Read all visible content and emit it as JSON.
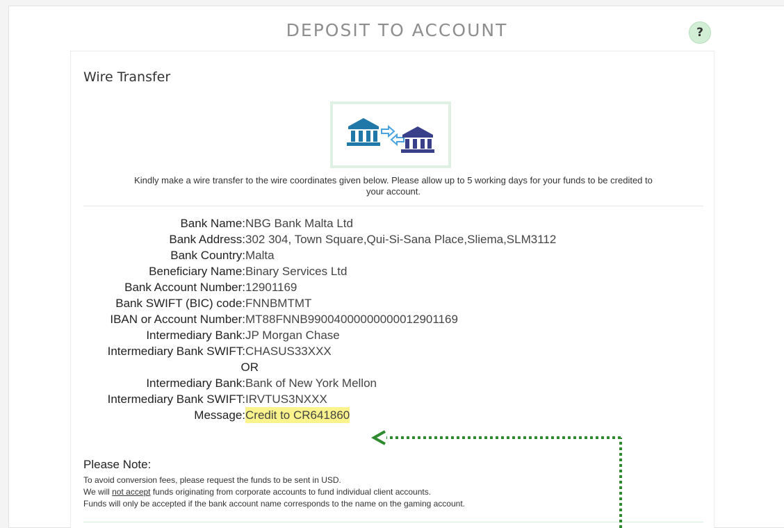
{
  "header": {
    "title": "DEPOSIT TO ACCOUNT",
    "help_label": "?"
  },
  "panel": {
    "title": "Wire Transfer",
    "logo_icon": "bank-transfer-icon",
    "instructions_line1": "Kindly make a wire transfer to the wire coordinates given below. Please allow up to 5 working days for your funds to be credited to",
    "instructions_line2": "your account."
  },
  "details": [
    {
      "label": "Bank Name:",
      "value": "NBG Bank Malta Ltd"
    },
    {
      "label": "Bank Address:",
      "value": "302 304, Town Square,Qui-Si-Sana Place,Sliema,SLM3112"
    },
    {
      "label": "Bank Country:",
      "value": "Malta"
    },
    {
      "label": "Beneficiary Name:",
      "value": "Binary Services Ltd"
    },
    {
      "label": "Bank Account Number:",
      "value": "12901169"
    },
    {
      "label": "Bank SWIFT (BIC) code:",
      "value": "FNNBMTMT"
    },
    {
      "label": "IBAN or Account Number:",
      "value": "MT88FNNB99004000000000012901169"
    },
    {
      "label": "Intermediary Bank:",
      "value": "JP Morgan Chase"
    },
    {
      "label": "Intermediary Bank SWIFT:",
      "value": "CHASUS33XXX"
    },
    {
      "label": "OR",
      "value": ""
    },
    {
      "label": "Intermediary Bank:",
      "value": "Bank of New York Mellon"
    },
    {
      "label": "Intermediary Bank SWIFT:",
      "value": "IRVTUS3NXXX"
    },
    {
      "label": "Message:",
      "value": "Credit to CR641860"
    }
  ],
  "note": {
    "title": "Please Note:",
    "line1": "To avoid conversion fees, please request the funds to be sent in USD.",
    "line2_prefix": "We will ",
    "line2_underline": "not accept",
    "line2_suffix": " funds originating from corporate accounts to fund individual client accounts.",
    "line3": "Funds will only be accepted if the bank account name corresponds to the name on the gaming account."
  },
  "colors": {
    "highlight": "#fbf38c",
    "arrow": "#2e8b2e",
    "help_bg": "#d2efd6"
  }
}
